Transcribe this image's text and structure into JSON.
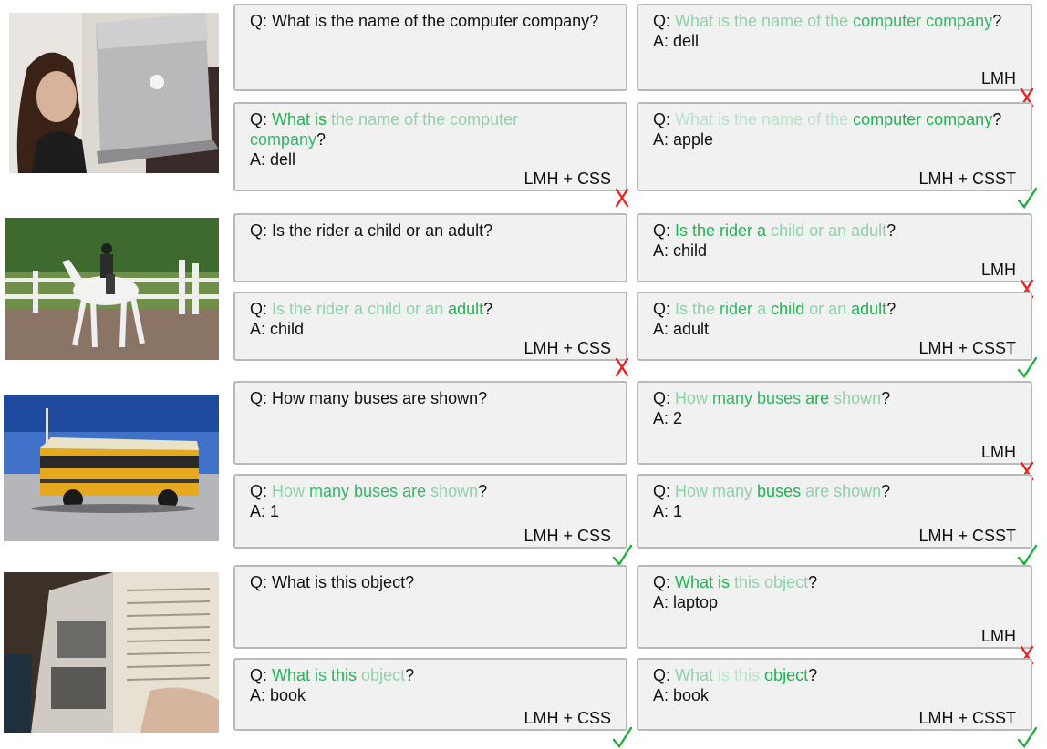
{
  "colors": {
    "strong": "#1fb550",
    "medium": "#33b767",
    "faint": "#8fd2a8",
    "vfaint": "#b8e3c8",
    "cross": "#ee2222",
    "check": "#1dae3c"
  },
  "rows": [
    {
      "image_icon": "laptop-photo",
      "boxes": [
        {
          "q_prefix": "Q: ",
          "tokens": [
            {
              "t": "What is the name of the computer company",
              "w": "none"
            }
          ],
          "q_suffix": "?",
          "answer": "",
          "method": "",
          "mark": ""
        },
        {
          "q_prefix": "Q: ",
          "tokens": [
            {
              "t": "What is the name of the ",
              "w": "faint"
            },
            {
              "t": "computer company",
              "w": "medium"
            }
          ],
          "q_suffix": "?",
          "answer": "A: dell",
          "method": "LMH",
          "mark": "cross"
        },
        {
          "q_prefix": "Q: ",
          "tokens": [
            {
              "t": "What is ",
              "w": "strong"
            },
            {
              "t": "the name of the computer ",
              "w": "faint"
            },
            {
              "t": "company",
              "w": "medium"
            }
          ],
          "q_suffix": "?",
          "answer": "A: dell",
          "method": "LMH + CSS",
          "mark": "cross"
        },
        {
          "q_prefix": "Q: ",
          "tokens": [
            {
              "t": "What is the name of the ",
              "w": "vfaint"
            },
            {
              "t": "computer company",
              "w": "strong"
            }
          ],
          "q_suffix": "?",
          "answer": "A: apple",
          "method": "LMH + CSST",
          "mark": "check"
        }
      ]
    },
    {
      "image_icon": "horse-rider-photo",
      "boxes": [
        {
          "q_prefix": "Q: ",
          "tokens": [
            {
              "t": "Is the rider a child or an adult",
              "w": "none"
            }
          ],
          "q_suffix": "?",
          "answer": "",
          "method": "",
          "mark": ""
        },
        {
          "q_prefix": "Q: ",
          "tokens": [
            {
              "t": "Is the rider a ",
              "w": "strong"
            },
            {
              "t": "child or an adult",
              "w": "faint"
            }
          ],
          "q_suffix": "?",
          "answer": "A: child",
          "method": "LMH",
          "mark": "cross"
        },
        {
          "q_prefix": "Q: ",
          "tokens": [
            {
              "t": "Is the rider a child or an ",
              "w": "faint"
            },
            {
              "t": "adult",
              "w": "strong"
            }
          ],
          "q_suffix": "?",
          "answer": "A: child",
          "method": "LMH + CSS",
          "mark": "cross"
        },
        {
          "q_prefix": "Q: ",
          "tokens": [
            {
              "t": "Is the ",
              "w": "faint"
            },
            {
              "t": "rider ",
              "w": "medium"
            },
            {
              "t": "a ",
              "w": "faint"
            },
            {
              "t": "child ",
              "w": "strong"
            },
            {
              "t": "or an ",
              "w": "faint"
            },
            {
              "t": "adult",
              "w": "strong"
            }
          ],
          "q_suffix": "?",
          "answer": "A: adult",
          "method": "LMH + CSST",
          "mark": "check"
        }
      ]
    },
    {
      "image_icon": "school-bus-photo",
      "boxes": [
        {
          "q_prefix": "Q: ",
          "tokens": [
            {
              "t": "How many buses are shown",
              "w": "none"
            }
          ],
          "q_suffix": "?",
          "answer": "",
          "method": "",
          "mark": ""
        },
        {
          "q_prefix": "Q: ",
          "tokens": [
            {
              "t": "How ",
              "w": "faint"
            },
            {
              "t": "many buses ",
              "w": "medium"
            },
            {
              "t": "are ",
              "w": "strong"
            },
            {
              "t": "shown",
              "w": "faint"
            }
          ],
          "q_suffix": "?",
          "answer": "A: 2",
          "method": "LMH",
          "mark": "cross"
        },
        {
          "q_prefix": "Q: ",
          "tokens": [
            {
              "t": "How ",
              "w": "faint"
            },
            {
              "t": "many buses are ",
              "w": "medium"
            },
            {
              "t": "shown",
              "w": "faint"
            }
          ],
          "q_suffix": "?",
          "answer": "A: 1",
          "method": "LMH + CSS",
          "mark": "check"
        },
        {
          "q_prefix": "Q: ",
          "tokens": [
            {
              "t": "How many ",
              "w": "faint"
            },
            {
              "t": "buses ",
              "w": "strong"
            },
            {
              "t": "are shown",
              "w": "faint"
            }
          ],
          "q_suffix": "?",
          "answer": "A: 1",
          "method": "LMH + CSST",
          "mark": "check"
        }
      ]
    },
    {
      "image_icon": "open-book-photo",
      "boxes": [
        {
          "q_prefix": "Q: ",
          "tokens": [
            {
              "t": "What is this object",
              "w": "none"
            }
          ],
          "q_suffix": "?",
          "answer": "",
          "method": "",
          "mark": ""
        },
        {
          "q_prefix": "Q: ",
          "tokens": [
            {
              "t": "What is ",
              "w": "strong"
            },
            {
              "t": "this object",
              "w": "faint"
            }
          ],
          "q_suffix": "?",
          "answer": "A: laptop",
          "method": "LMH",
          "mark": "cross"
        },
        {
          "q_prefix": "Q: ",
          "tokens": [
            {
              "t": "What ",
              "w": "strong"
            },
            {
              "t": "is ",
              "w": "medium"
            },
            {
              "t": "this ",
              "w": "strong"
            },
            {
              "t": "object",
              "w": "faint"
            }
          ],
          "q_suffix": "?",
          "answer": "A: book",
          "method": "LMH + CSS",
          "mark": "check"
        },
        {
          "q_prefix": "Q: ",
          "tokens": [
            {
              "t": "What ",
              "w": "faint"
            },
            {
              "t": "is this ",
              "w": "vfaint"
            },
            {
              "t": "object",
              "w": "strong"
            }
          ],
          "q_suffix": "?",
          "answer": "A: book",
          "method": "LMH + CSST",
          "mark": "check"
        }
      ]
    }
  ]
}
